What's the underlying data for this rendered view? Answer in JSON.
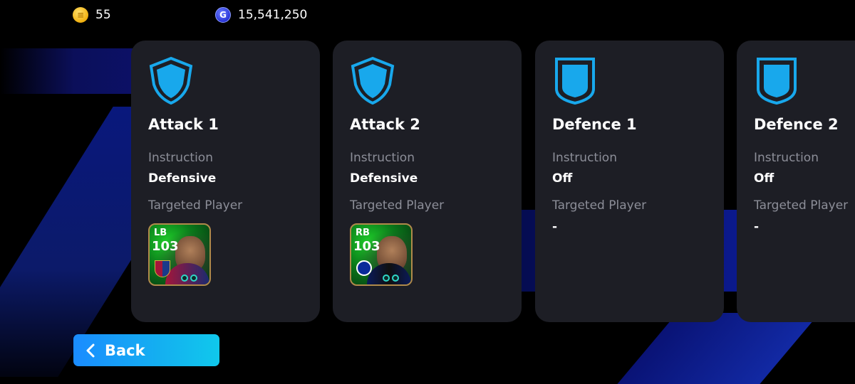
{
  "currencies": {
    "coins": {
      "icon": "coin-icon",
      "value": "55",
      "color": "#f4c430"
    },
    "gp": {
      "icon": "gp-icon",
      "symbol": "G",
      "value": "15,541,250",
      "color": "#2a36d8"
    }
  },
  "cards": [
    {
      "title": "Attack 1",
      "icon": "attack-shield-icon",
      "instruction_label": "Instruction",
      "instruction_value": "Defensive",
      "target_label": "Targeted Player",
      "player": {
        "position": "LB",
        "rating": "103",
        "club_icon": "barcelona-crest-icon"
      }
    },
    {
      "title": "Attack 2",
      "icon": "attack-shield-icon",
      "instruction_label": "Instruction",
      "instruction_value": "Defensive",
      "target_label": "Targeted Player",
      "player": {
        "position": "RB",
        "rating": "103",
        "club_icon": "inter-crest-icon"
      }
    },
    {
      "title": "Defence 1",
      "icon": "defence-shield-icon",
      "instruction_label": "Instruction",
      "instruction_value": "Off",
      "target_label": "Targeted Player",
      "target_value": "-"
    },
    {
      "title": "Defence 2",
      "icon": "defence-shield-icon",
      "instruction_label": "Instruction",
      "instruction_value": "Off",
      "target_label": "Targeted Player",
      "target_value": "-"
    }
  ],
  "back_button": {
    "label": "Back",
    "icon": "chevron-left-icon"
  },
  "colors": {
    "accent": "#1aa0ff",
    "card_bg": "#1d1e25",
    "label_gray": "#8c8e98",
    "shield_blue": "#18a8ec"
  }
}
